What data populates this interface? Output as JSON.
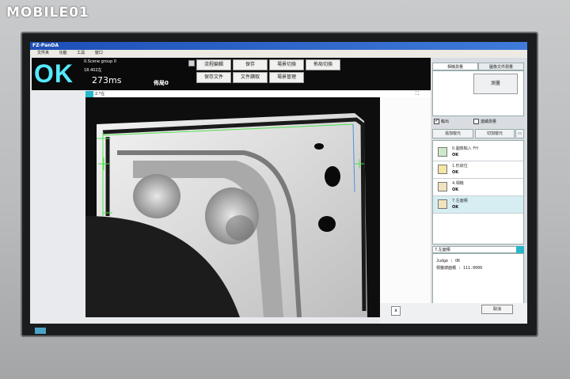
{
  "watermark": "MOBILE01",
  "window": {
    "title": "FZ-PanDA"
  },
  "menu": [
    "文件夹",
    "功能",
    "工具",
    "窗口"
  ],
  "status": {
    "judge": "OK",
    "scene": "0.Scene group 0",
    "scene_value": "18.402左",
    "time": "273ms",
    "layout": "佈局0"
  },
  "toolbar": {
    "row1": [
      "流程編輯",
      "保存",
      "場景切換",
      "佈局切換"
    ],
    "row2": [
      "保存文件",
      "文件讀取",
      "場景管理"
    ]
  },
  "image": {
    "header": "2.*左",
    "camera_icon": "camera-icon"
  },
  "right": {
    "tabs": [
      "相機測量",
      "圖像文件測量"
    ],
    "measure_button": "測量",
    "checks": [
      {
        "label": "輸出",
        "checked": true
      },
      {
        "label": "連續測量",
        "checked": false
      }
    ],
    "buttons": [
      "追加窗元",
      "切加窗元"
    ],
    "flow": [
      {
        "name": "0.圖像輸入 FH",
        "result": "OK"
      },
      {
        "name": "1.形狀位",
        "result": "OK"
      },
      {
        "name": "4.相機",
        "result": "OK"
      },
      {
        "name": "7.左面積",
        "result": "OK"
      }
    ],
    "result_header": "7.左面積",
    "result_lines": [
      "Judge : OK",
      "標籤總面積 : 111.0000"
    ]
  },
  "footer": {
    "close": "x",
    "cancel": "取消"
  },
  "colors": {
    "ok": "#55e8ff",
    "accent": "#26b7c8",
    "title": "#1d4fb7"
  }
}
